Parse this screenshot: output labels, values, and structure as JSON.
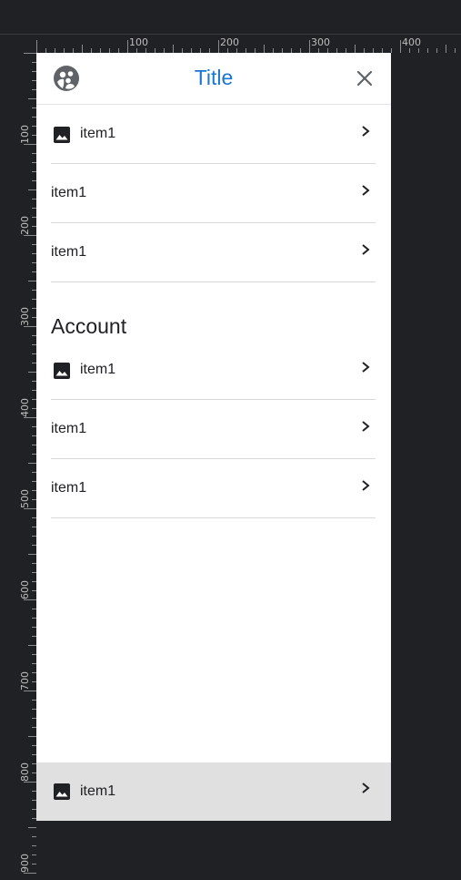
{
  "ruler": {
    "top_labels": [
      "100",
      "200",
      "300",
      "400"
    ],
    "left_labels": [
      "100",
      "200",
      "300",
      "400",
      "500",
      "600",
      "700",
      "800",
      "900"
    ]
  },
  "panel": {
    "header": {
      "logo_icon": "group-avatar-icon",
      "title": "Title",
      "close_icon": "close-icon",
      "accent": "#1976d2"
    },
    "items_top": [
      {
        "label": "item1",
        "icon": "image-icon"
      },
      {
        "label": "item1"
      },
      {
        "label": "item1"
      }
    ],
    "section_title": "Account",
    "items_account": [
      {
        "label": "item1",
        "icon": "image-icon"
      },
      {
        "label": "item1"
      },
      {
        "label": "item1"
      }
    ],
    "footer_item": {
      "label": "item1",
      "icon": "image-icon",
      "background": "#e0e0e0"
    }
  }
}
